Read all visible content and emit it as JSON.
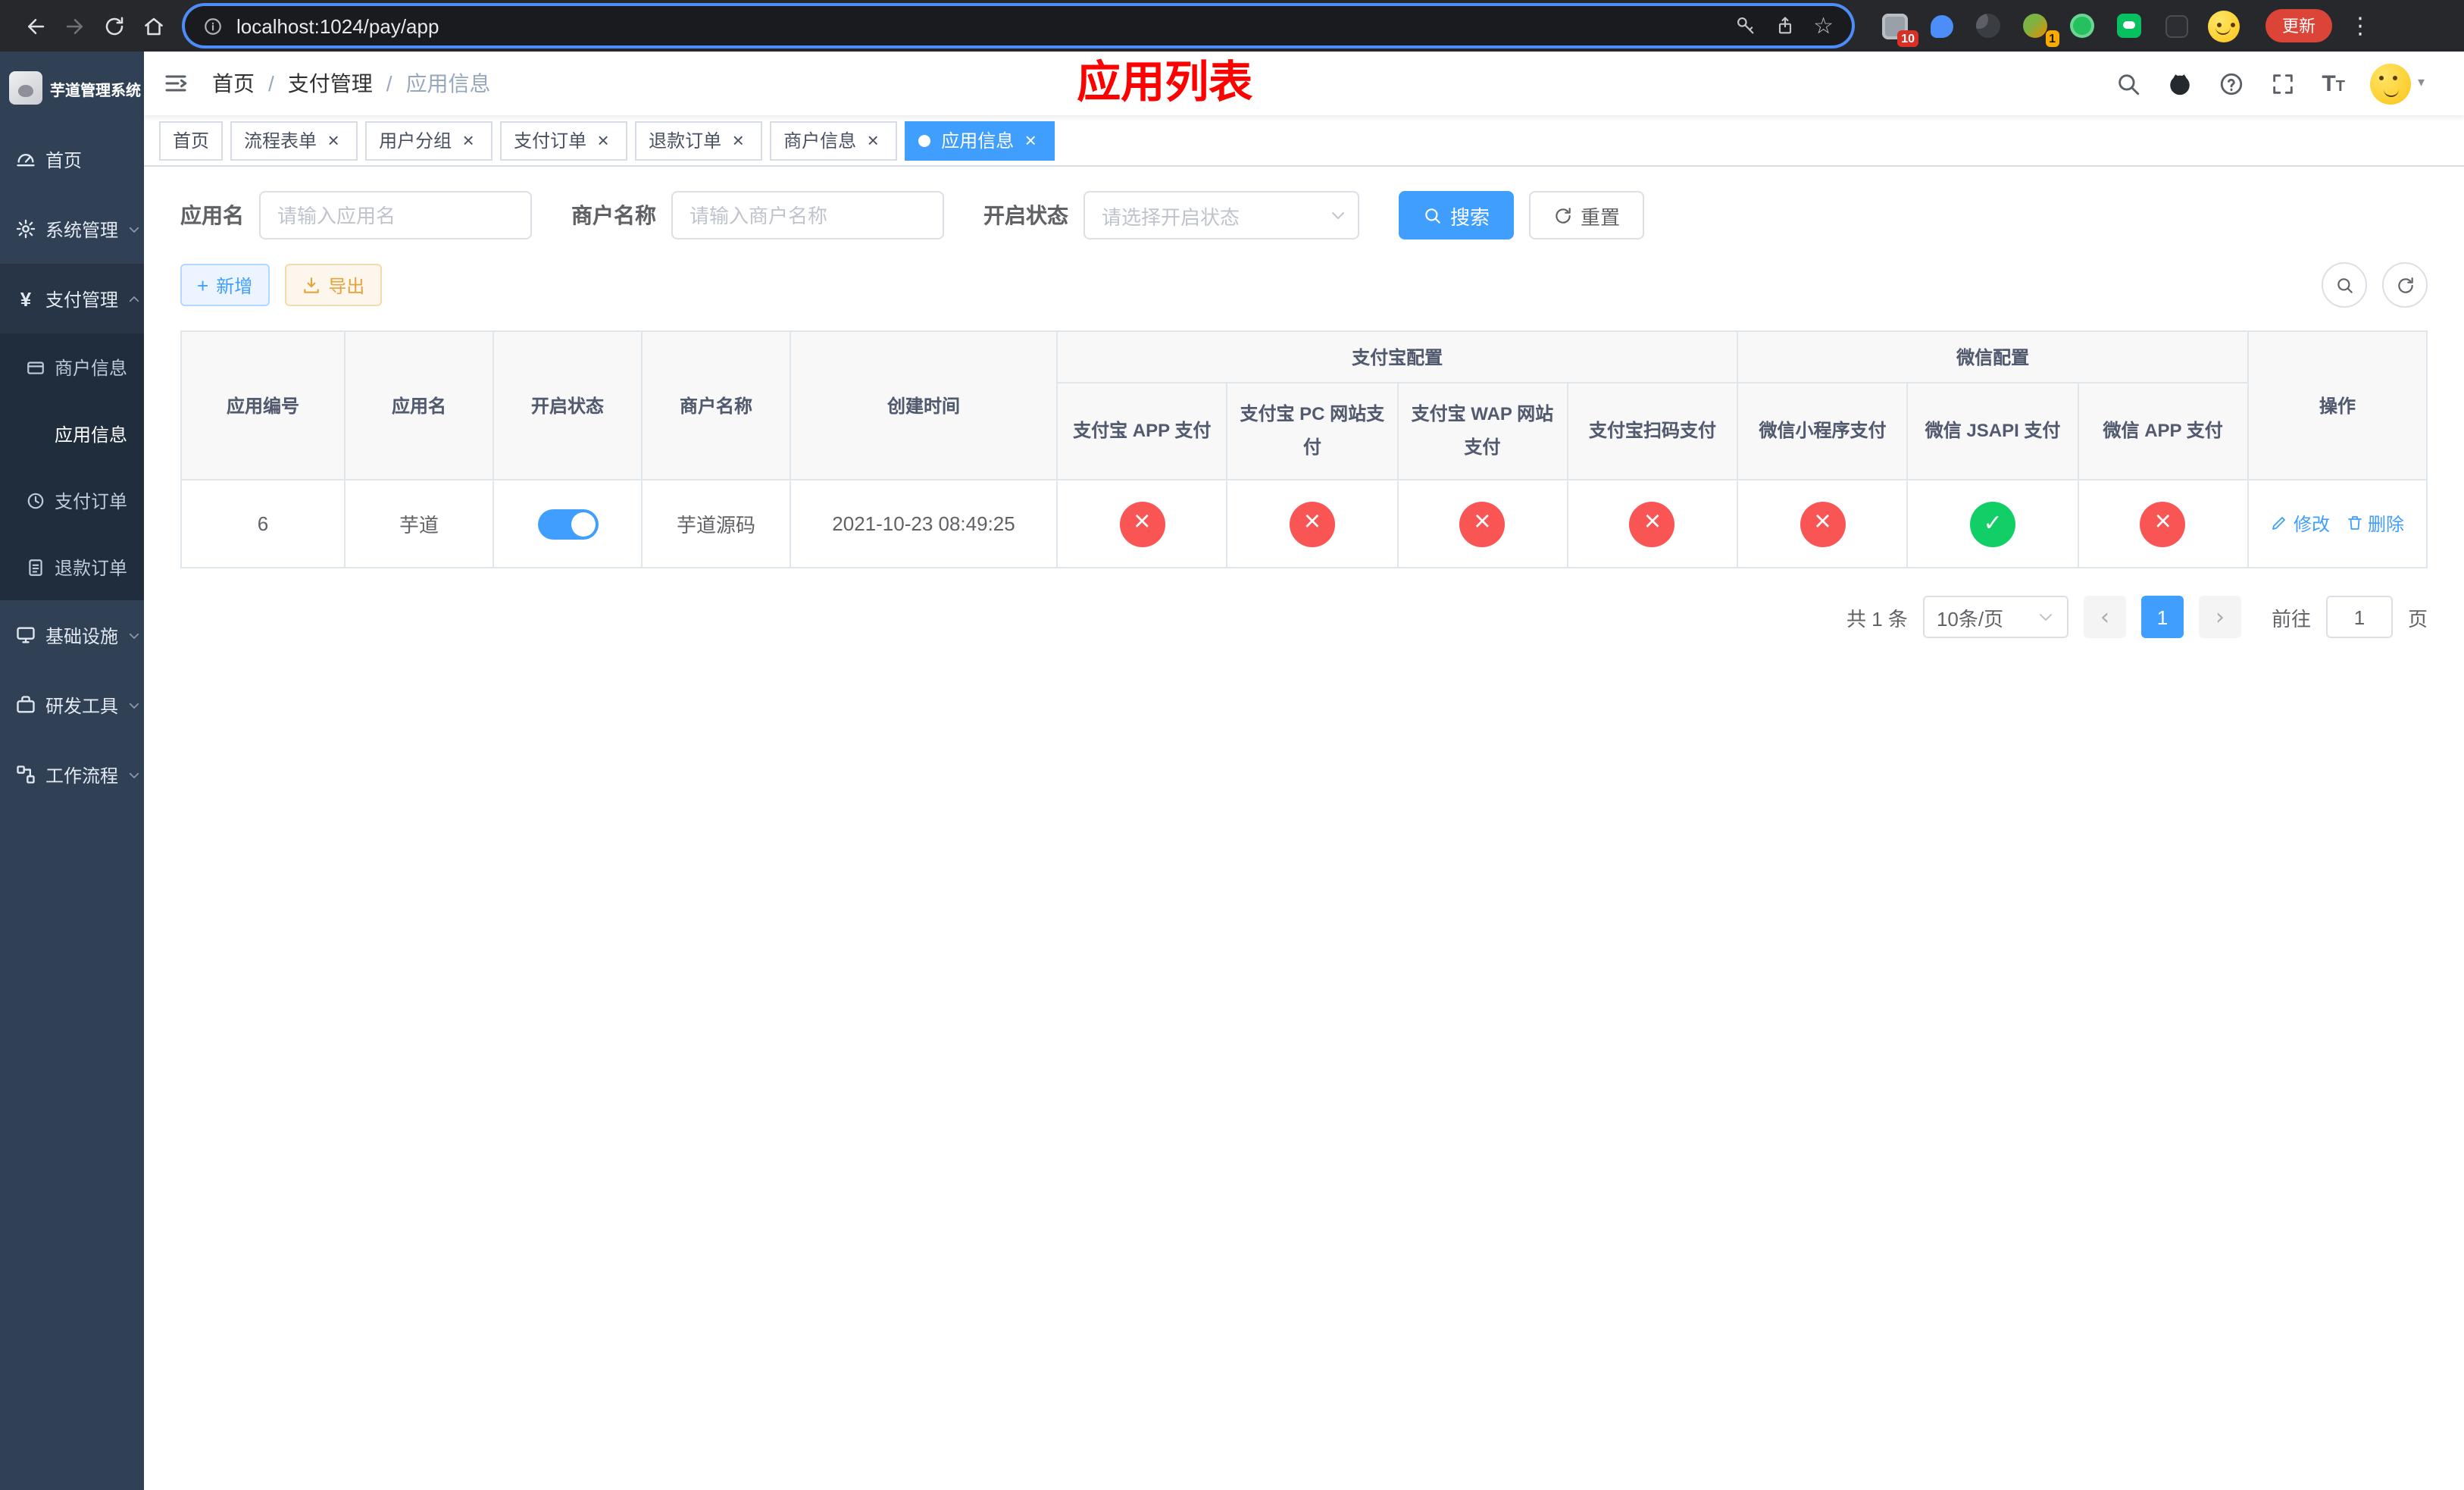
{
  "theme": {
    "primary": "#409eff",
    "danger": "#fa5555",
    "success": "#12ce66",
    "warning": "#e6a23c",
    "title_red": "#ff0000",
    "sidebar_bg": "#304156",
    "submenu_bg": "#1f2d3d",
    "chrome_bg": "#26282c"
  },
  "icons": {
    "star": "☆",
    "more": "⋮",
    "caret": "▾",
    "yen": "¥",
    "close": "×",
    "slash": "/",
    "prev": "‹",
    "next": "›",
    "plus": "+",
    "font_size_big": "T",
    "font_size_small": "T"
  },
  "browser": {
    "url": "localhost:1024/pay/app",
    "update_button": "更新",
    "badge_1": "10",
    "badge_2": "1"
  },
  "app_title": "芋道管理系统",
  "sidebar": {
    "items": [
      {
        "label": "首页",
        "active": false
      },
      {
        "label": "系统管理",
        "expanded": false
      },
      {
        "label": "支付管理",
        "expanded": true,
        "children": [
          {
            "label": "商户信息",
            "active": false
          },
          {
            "label": "应用信息",
            "active": true
          },
          {
            "label": "支付订单",
            "active": false
          },
          {
            "label": "退款订单",
            "active": false
          }
        ]
      },
      {
        "label": "基础设施",
        "expanded": false
      },
      {
        "label": "研发工具",
        "expanded": false
      },
      {
        "label": "工作流程",
        "expanded": false
      }
    ]
  },
  "header": {
    "breadcrumb": [
      {
        "label": "首页"
      },
      {
        "label": "支付管理"
      },
      {
        "label": "应用信息"
      }
    ],
    "title": "应用列表"
  },
  "tabs": [
    {
      "label": "首页",
      "closable": false,
      "active": false
    },
    {
      "label": "流程表单",
      "closable": true,
      "active": false
    },
    {
      "label": "用户分组",
      "closable": true,
      "active": false
    },
    {
      "label": "支付订单",
      "closable": true,
      "active": false
    },
    {
      "label": "退款订单",
      "closable": true,
      "active": false
    },
    {
      "label": "商户信息",
      "closable": true,
      "active": false
    },
    {
      "label": "应用信息",
      "closable": true,
      "active": true
    }
  ],
  "filters": {
    "app_name_label": "应用名",
    "app_name_placeholder": "请输入应用名",
    "merchant_label": "商户名称",
    "merchant_placeholder": "请输入商户名称",
    "status_label": "开启状态",
    "status_placeholder": "请选择开启状态",
    "search": "搜索",
    "reset": "重置"
  },
  "toolbar": {
    "add": "新增",
    "export": "导出"
  },
  "table": {
    "headers": {
      "app_id": "应用编号",
      "app_name": "应用名",
      "status": "开启状态",
      "merchant": "商户名称",
      "created": "创建时间",
      "alipay_group": "支付宝配置",
      "wechat_group": "微信配置",
      "alipay_app": "支付宝 APP 支付",
      "alipay_pc": "支付宝 PC 网站支付",
      "alipay_wap": "支付宝 WAP 网站支付",
      "alipay_scan": "支付宝扫码支付",
      "wechat_mini": "微信小程序支付",
      "wechat_jsapi": "微信 JSAPI 支付",
      "wechat_app": "微信 APP 支付",
      "actions": "操作"
    },
    "row": {
      "id": "6",
      "name": "芋道",
      "enabled": true,
      "merchant": "芋道源码",
      "created": "2021-10-23 08:49:25",
      "alipay_app": false,
      "alipay_pc": false,
      "alipay_wap": false,
      "alipay_scan": false,
      "wechat_mini": false,
      "wechat_jsapi": true,
      "wechat_app": false,
      "edit": "修改",
      "delete": "删除"
    }
  },
  "pagination": {
    "total": "共 1 条",
    "page_size": "10条/页",
    "page": "1",
    "goto": "前往",
    "goto_value": "1",
    "unit": "页"
  }
}
